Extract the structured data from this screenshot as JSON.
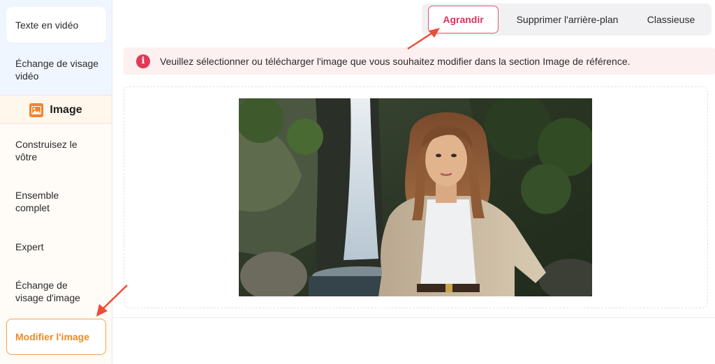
{
  "sidebar": {
    "video_items": [
      {
        "label": "Texte en vidéo"
      },
      {
        "label": "Échange de visage vidéo"
      }
    ],
    "section": {
      "label": "Image",
      "icon": "image-icon"
    },
    "image_items": [
      {
        "label": "Construisez le vôtre"
      },
      {
        "label": "Ensemble complet"
      },
      {
        "label": "Expert"
      },
      {
        "label": "Échange de visage d'image"
      }
    ],
    "active_item": {
      "label": "Modifier l'image"
    }
  },
  "tabs": [
    {
      "label": "Agrandir",
      "active": true
    },
    {
      "label": "Supprimer l'arrière-plan",
      "active": false
    },
    {
      "label": "Classieuse",
      "active": false
    }
  ],
  "alert": {
    "icon": "info-icon",
    "glyph": "i",
    "text": "Veuillez sélectionner ou télécharger l'image que vous souhaitez modifier dans la section Image de référence."
  },
  "colors": {
    "accent_red": "#e3556d",
    "accent_orange": "#f4a24d",
    "arrow_red": "#ee4a3a"
  }
}
